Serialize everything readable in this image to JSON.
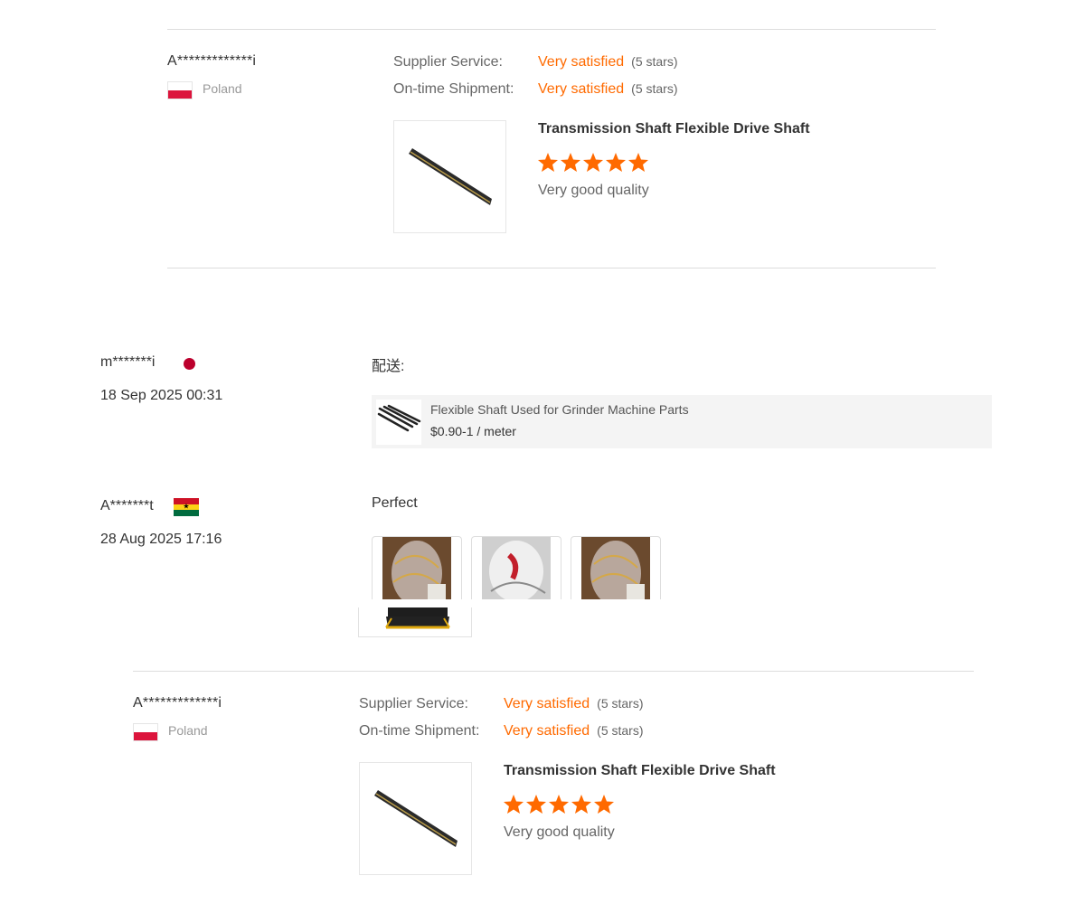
{
  "reviews_top": {
    "reviewer_name": "A*************i",
    "country": "Poland",
    "supplier_service_label": "Supplier Service:",
    "supplier_service_value": "Very satisfied",
    "supplier_service_stars": "(5 stars)",
    "shipment_label": "On-time Shipment:",
    "shipment_value": "Very satisfied",
    "shipment_stars": "(5 stars)",
    "product_title": "Transmission Shaft Flexible Drive Shaft",
    "rating": 5,
    "comment": "Very good quality"
  },
  "review_jp": {
    "reviewer_name": "m*******i",
    "date": "18 Sep 2025 00:31",
    "text": "配送:",
    "product_title": "Flexible Shaft Used for Grinder Machine Parts",
    "product_price": "$0.90-1 / meter"
  },
  "review_gh": {
    "reviewer_name": "A*******t",
    "date": "28 Aug 2025 17:16",
    "text": "Perfect",
    "photo_count": 3
  },
  "reviews_bottom": {
    "reviewer_name": "A*************i",
    "country": "Poland",
    "supplier_service_label": "Supplier Service:",
    "supplier_service_value": "Very satisfied",
    "supplier_service_stars": "(5 stars)",
    "shipment_label": "On-time Shipment:",
    "shipment_value": "Very satisfied",
    "shipment_stars": "(5 stars)",
    "product_title": "Transmission Shaft Flexible Drive Shaft",
    "rating": 5,
    "comment": "Very good quality"
  },
  "colors": {
    "accent": "#ff6a00",
    "divider": "#dddddd",
    "card_bg": "#f4f4f4"
  },
  "icons": {
    "star": "star-icon",
    "flag_poland": "poland-flag-icon",
    "flag_ghana": "ghana-flag-icon",
    "flag_japan": "japan-flag-dot-icon"
  }
}
